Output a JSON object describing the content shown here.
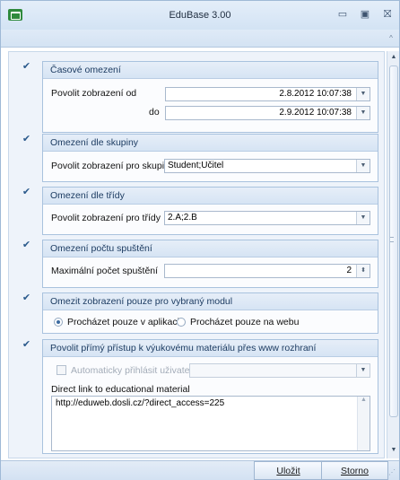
{
  "window": {
    "title": "EduBase 3.00",
    "buttons": {
      "minimize": "▭",
      "restore": "▣",
      "close": "⛝"
    },
    "collapse_ribbon_icon": "^"
  },
  "sections": {
    "time_limit": {
      "checked": true,
      "header": "Časové omezení",
      "from_label": "Povolit zobrazení od",
      "from_value": "2.8.2012 10:07:38",
      "to_label": "do",
      "to_value": "2.9.2012 10:07:38"
    },
    "group_limit": {
      "checked": true,
      "header": "Omezení dle skupiny",
      "label": "Povolit zobrazení pro skupiny",
      "value": "Student;Učitel"
    },
    "class_limit": {
      "checked": true,
      "header": "Omezení dle třídy",
      "label": "Povolit zobrazení pro třídy",
      "value": "2.A;2.B"
    },
    "run_count": {
      "checked": true,
      "header": "Omezení počtu spuštění",
      "label": "Maximální počet spuštění",
      "value": "2"
    },
    "module_limit": {
      "checked": true,
      "header": "Omezit zobrazení pouze pro vybraný modul",
      "option_app": "Procházet pouze v aplikaci",
      "option_web": "Procházet pouze na webu",
      "selected": "app"
    },
    "direct_access": {
      "checked": true,
      "header": "Povolit přímý přístup k výukovému materiálu přes www rozhraní",
      "auto_login_label": "Automaticky přihlásit uživatele",
      "link_label": "Direct link to educational material",
      "link_value": "http://eduweb.dosli.cz/?direct_access=225"
    }
  },
  "footer": {
    "save_label": "Uložit",
    "cancel_label": "Storno"
  }
}
